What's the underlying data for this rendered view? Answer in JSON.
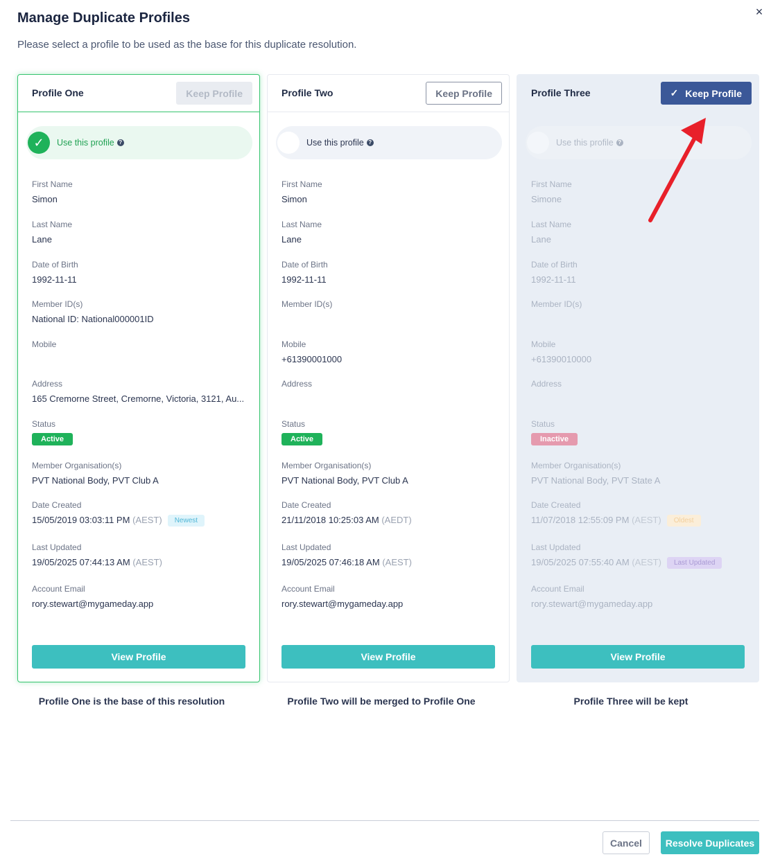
{
  "dialog": {
    "title": "Manage Duplicate Profiles",
    "subtitle": "Please select a profile to be used as the base for this duplicate resolution.",
    "close_icon": "×"
  },
  "labels": {
    "first_name": "First Name",
    "last_name": "Last Name",
    "dob": "Date of Birth",
    "member_ids": "Member ID(s)",
    "mobile": "Mobile",
    "address": "Address",
    "status": "Status",
    "member_orgs": "Member Organisation(s)",
    "date_created": "Date Created",
    "last_updated": "Last Updated",
    "account_email": "Account Email"
  },
  "profiles": [
    {
      "name": "Profile One",
      "keep_label": "Keep Profile",
      "keep_state": "disabled",
      "use_label": "Use this profile",
      "selected": true,
      "first_name": "Simon",
      "last_name": "Lane",
      "dob": "1992-11-11",
      "member_ids": "National ID: National000001ID",
      "mobile": "",
      "address": "165 Cremorne Street, Cremorne, Victoria, 3121, Au...",
      "status": "Active",
      "member_orgs": "PVT National Body, PVT Club A",
      "date_created": "15/05/2019 03:03:11 PM",
      "date_created_tz": "(AEST)",
      "date_created_tag": "Newest",
      "last_updated": "19/05/2025 07:44:13 AM",
      "last_updated_tz": "(AEST)",
      "last_updated_tag": "",
      "account_email": "rory.stewart@mygameday.app",
      "view_label": "View Profile",
      "caption": "Profile One is the base of this resolution"
    },
    {
      "name": "Profile Two",
      "keep_label": "Keep Profile",
      "keep_state": "outline",
      "use_label": "Use this profile",
      "selected": false,
      "first_name": "Simon",
      "last_name": "Lane",
      "dob": "1992-11-11",
      "member_ids": "",
      "mobile": "+61390001000",
      "address": "",
      "status": "Active",
      "member_orgs": "PVT National Body, PVT Club A",
      "date_created": "21/11/2018 10:25:03 AM",
      "date_created_tz": "(AEDT)",
      "date_created_tag": "",
      "last_updated": "19/05/2025 07:46:18 AM",
      "last_updated_tz": "(AEST)",
      "last_updated_tag": "",
      "account_email": "rory.stewart@mygameday.app",
      "view_label": "View Profile",
      "caption": "Profile Two will be merged to Profile One"
    },
    {
      "name": "Profile Three",
      "keep_label": "Keep Profile",
      "keep_state": "active",
      "use_label": "Use this profile",
      "selected": false,
      "first_name": "Simone",
      "last_name": "Lane",
      "dob": "1992-11-11",
      "member_ids": "",
      "mobile": "+61390010000",
      "address": "",
      "status": "Inactive",
      "member_orgs": "PVT National Body, PVT State A",
      "date_created": "11/07/2018 12:55:09 PM",
      "date_created_tz": "(AEST)",
      "date_created_tag": "Oldest",
      "last_updated": "19/05/2025 07:55:40 AM",
      "last_updated_tz": "(AEST)",
      "last_updated_tag": "Last Updated",
      "account_email": "rory.stewart@mygameday.app",
      "view_label": "View Profile",
      "caption": "Profile Three will be kept"
    }
  ],
  "footer": {
    "cancel_label": "Cancel",
    "resolve_label": "Resolve Duplicates"
  },
  "colors": {
    "selected_green": "#1fb25a",
    "keep_active_blue": "#3b5898",
    "teal_button": "#3dbfbf",
    "annotation_arrow": "#e8202a"
  }
}
